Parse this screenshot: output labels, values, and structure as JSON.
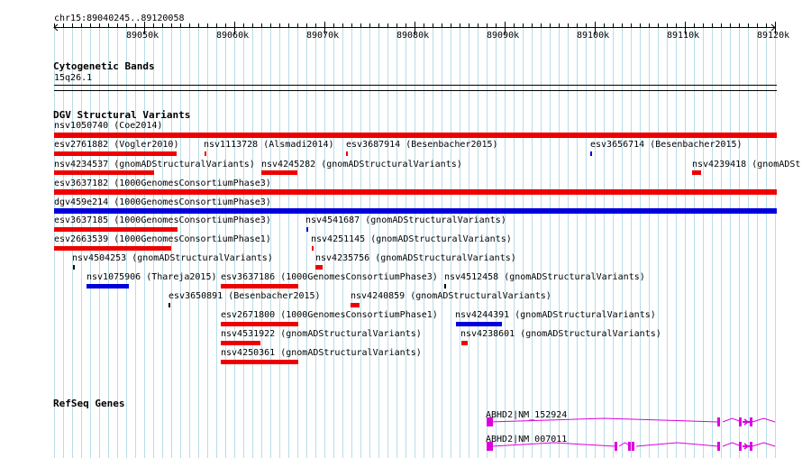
{
  "browser": {
    "region": "chr15:89040245..89120058",
    "ruler_ticks": [
      "89050k",
      "89060k",
      "89070k",
      "89080k",
      "89090k",
      "89100k",
      "89110k",
      "89120k"
    ]
  },
  "tracks": {
    "cytoband": {
      "title": "Cytogenetic Bands",
      "band": "15q26.1"
    },
    "dgv": {
      "title": "DGV Structural Variants",
      "colors": {
        "loss": "#ee0000",
        "gain": "#0000dd",
        "point": "#000000"
      },
      "features": [
        {
          "label": "nsv1050740 (Coe2014)",
          "type": "loss"
        },
        {
          "label": "esv2761882 (Vogler2010)",
          "type": "loss"
        },
        {
          "label": "nsv1113728 (Alsmadi2014)",
          "type": "loss"
        },
        {
          "label": "esv3687914 (Besenbacher2015)",
          "type": "loss"
        },
        {
          "label": "esv3656714 (Besenbacher2015)",
          "type": "gain"
        },
        {
          "label": "nsv4234537 (gnomADStructuralVariants)",
          "type": "loss"
        },
        {
          "label": "nsv4245282 (gnomADStructuralVariants)",
          "type": "loss"
        },
        {
          "label": "nsv4239418 (gnomADSt",
          "type": "loss"
        },
        {
          "label": "esv3637182 (1000GenomesConsortiumPhase3)",
          "type": "loss"
        },
        {
          "label": "dgv459e214 (1000GenomesConsortiumPhase3)",
          "type": "gain"
        },
        {
          "label": "esv3637185 (1000GenomesConsortiumPhase3)",
          "type": "loss"
        },
        {
          "label": "nsv4541687 (gnomADStructuralVariants)",
          "type": "gain"
        },
        {
          "label": "esv2663539 (1000GenomesConsortiumPhase1)",
          "type": "loss"
        },
        {
          "label": "nsv4251145 (gnomADStructuralVariants)",
          "type": "loss"
        },
        {
          "label": "nsv4504253 (gnomADStructuralVariants)",
          "type": "point"
        },
        {
          "label": "nsv4235756 (gnomADStructuralVariants)",
          "type": "loss"
        },
        {
          "label": "nsv1075906 (Thareja2015)",
          "type": "gain"
        },
        {
          "label": "esv3637186 (1000GenomesConsortiumPhase3)",
          "type": "loss"
        },
        {
          "label": "nsv4512458 (gnomADStructuralVariants)",
          "type": "point"
        },
        {
          "label": "esv3650891 (Besenbacher2015)",
          "type": "point"
        },
        {
          "label": "nsv4240859 (gnomADStructuralVariants)",
          "type": "loss"
        },
        {
          "label": "esv2671800 (1000GenomesConsortiumPhase1)",
          "type": "loss"
        },
        {
          "label": "nsv4244391 (gnomADStructuralVariants)",
          "type": "gain"
        },
        {
          "label": "nsv4531922 (gnomADStructuralVariants)",
          "type": "loss"
        },
        {
          "label": "nsv4238601 (gnomADStructuralVariants)",
          "type": "loss"
        },
        {
          "label": "nsv4250361 (gnomADStructuralVariants)",
          "type": "loss"
        }
      ]
    },
    "refseq": {
      "title": "RefSeq Genes",
      "color": "#dd00dd",
      "transcripts": [
        {
          "label": "ABHD2|NM_152924"
        },
        {
          "label": "ABHD2|NM_007011"
        }
      ]
    }
  }
}
